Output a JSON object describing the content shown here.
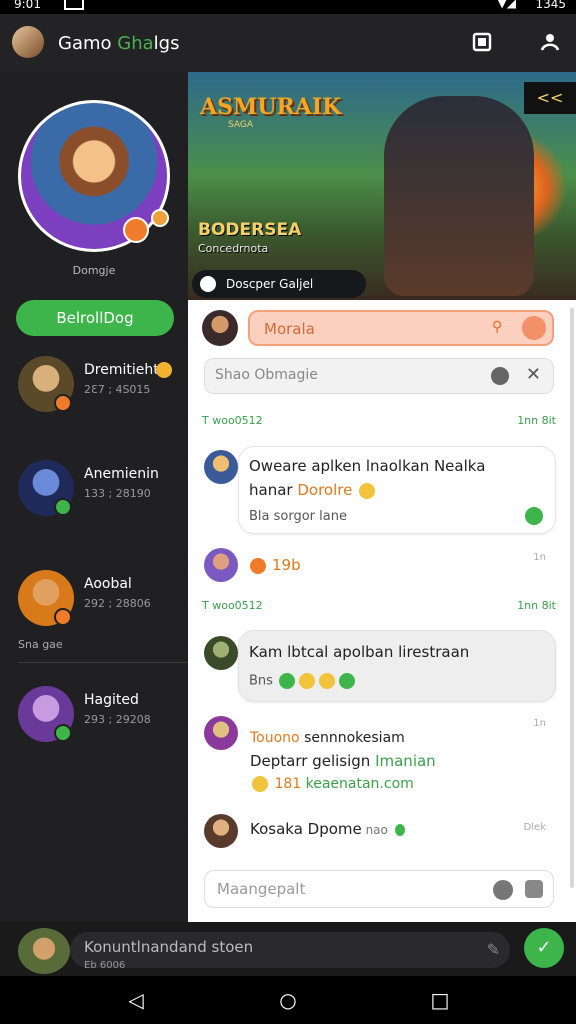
{
  "status": {
    "time": "9:01",
    "battery": "1345"
  },
  "app": {
    "title_a": "Gamo ",
    "title_b": "Gha",
    "title_c": "lgs"
  },
  "profile": {
    "handle": "Domgje",
    "button": "BelrollDog"
  },
  "friends": [
    {
      "name": "Dremitiehte",
      "meta": "2Ɛ7 ; 4S015",
      "badge_color": "#f07b2a"
    },
    {
      "name": "Anemienin",
      "meta": "133 ; 28190",
      "badge_color": "#3db54a"
    },
    {
      "name": "Aoobal",
      "meta": "292 ; 28806",
      "badge_color": "#f07b2a"
    },
    {
      "name": "Hagited",
      "meta": "293 ; 29208",
      "badge_color": "#3db54a"
    }
  ],
  "sidebar_caption": "Sna gae",
  "hero": {
    "logo": "ASMURAIK",
    "logo_sub": "SAGA",
    "game_title": "BODERSEA",
    "game_sub": "Concedrnota",
    "chip": "Doscper Galjel",
    "corner": "<<"
  },
  "chat": {
    "search_value": "Morala",
    "filter_placeholder": "Shao Obmagie",
    "section1_left": "T woo0512",
    "section1_right": "1nn 8it",
    "msg1_line1": "Oweare aplken lnaolkan Nealka",
    "msg1_line2a": "hanar ",
    "msg1_line2b": "Dorolre",
    "msg1_sub": "Bla sorgor lane",
    "msg2_text": "19b",
    "msg2_time": "1n",
    "section2_left": "T woo0512",
    "section2_right": "1nn 8it",
    "msg3_line1": "Kam lbtcal apolban lirestraan",
    "msg3_sub": "Bns",
    "msg4_time": "1n",
    "msg4_name": "Touono",
    "msg4_rest": " sennnokesiam",
    "msg4_line2a": "Deptarr gelisign ",
    "msg4_line2b": "Imanian",
    "msg4_line3a": " 181 ",
    "msg4_line3b": "keaenatan.com",
    "msg5_text": "Kosaka Dpome",
    "msg5_extra": " nao",
    "msg5_time": "Dlek",
    "composer_placeholder": "Maangepalt"
  },
  "bottom": {
    "input": "Konuntlnandand stoen",
    "input_sub": "Eb 6006"
  }
}
